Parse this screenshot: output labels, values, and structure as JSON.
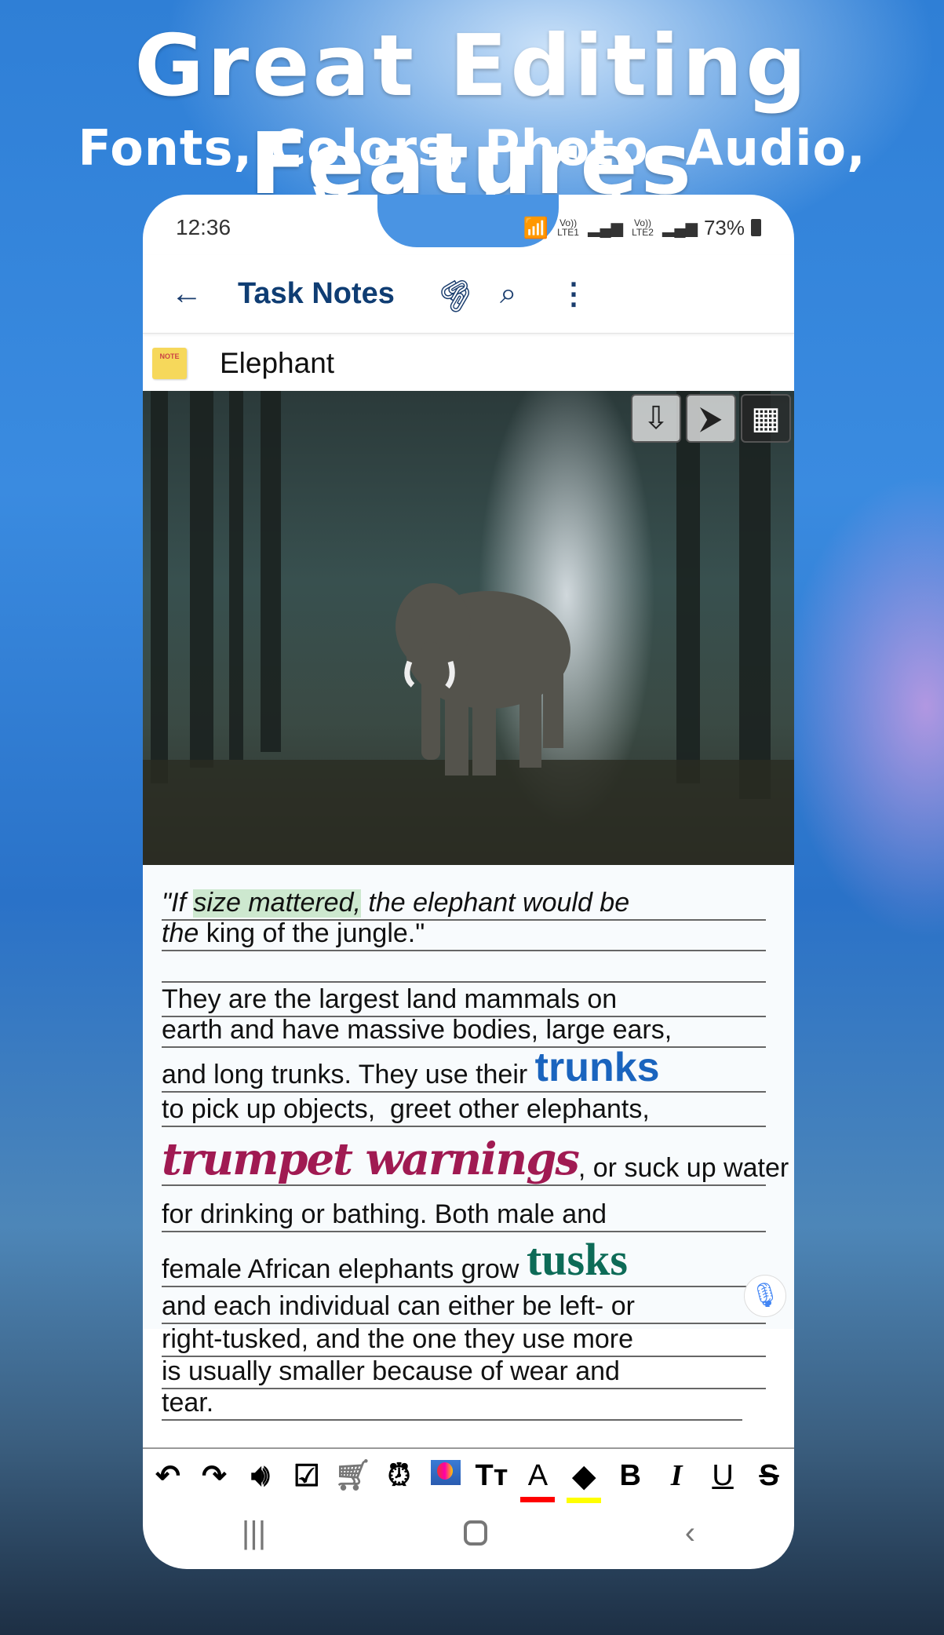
{
  "promo": {
    "title": "Great Editing Features",
    "subtitle": "Fonts, Colors, Photo, Audio, Voice Input"
  },
  "status": {
    "time": "12:36",
    "lte1": "Vo)) LTE1",
    "lte2": "Vo)) LTE2",
    "battery": "73%"
  },
  "appbar": {
    "title": "Task Notes",
    "icons": [
      "back-arrow-icon",
      "paperclip-icon",
      "search-icon",
      "more-vert-icon"
    ]
  },
  "note": {
    "title": "Elephant",
    "icon_label": "NOTE"
  },
  "photo": {
    "buttons": [
      "download-icon",
      "shrink-icon",
      "grid-icon"
    ]
  },
  "body": {
    "l1a": "\"If ",
    "l1b": "size mattered,",
    "l1c": " the elephant would be",
    "l2a": "the",
    "l2b": " king of the jungle.\"",
    "l3": "They are the largest land mammals on",
    "l4": "earth and have massive bodies, large ears,",
    "l5a": "and long trunks. They use their ",
    "l5b": "trunks",
    "l6": "to pick up objects,  greet other elephants,",
    "l7a": "trumpet warnings",
    "l7b": ", or suck up water",
    "l8": "for drinking or bathing. Both male and",
    "l9a": "female African elephants grow ",
    "l9b": "tusks",
    "l10": "and each individual can either be left- or",
    "l11": "right-tusked, and the one they use more",
    "l12": "is usually smaller because of wear and",
    "l13": "tear."
  },
  "colors": {
    "highlight": "#cde8cf",
    "trunks": "#1a64be",
    "trumpet": "#a01a52",
    "tusks": "#0d6b57",
    "font_color_bar": "#ff0000",
    "fill_color_bar": "#ffff00",
    "title": "#0f3d73"
  },
  "toolbar": {
    "items": [
      "undo",
      "redo",
      "speaker",
      "checkbox",
      "shopping-cart-checklist",
      "alarm-add",
      "photo",
      "text-size",
      "font-color",
      "fill-color",
      "bold",
      "italic",
      "underline",
      "strikethrough"
    ],
    "bold": "B",
    "italic": "I",
    "underline": "U",
    "strike": "S",
    "font_color": "A",
    "text_size": "Tт"
  }
}
